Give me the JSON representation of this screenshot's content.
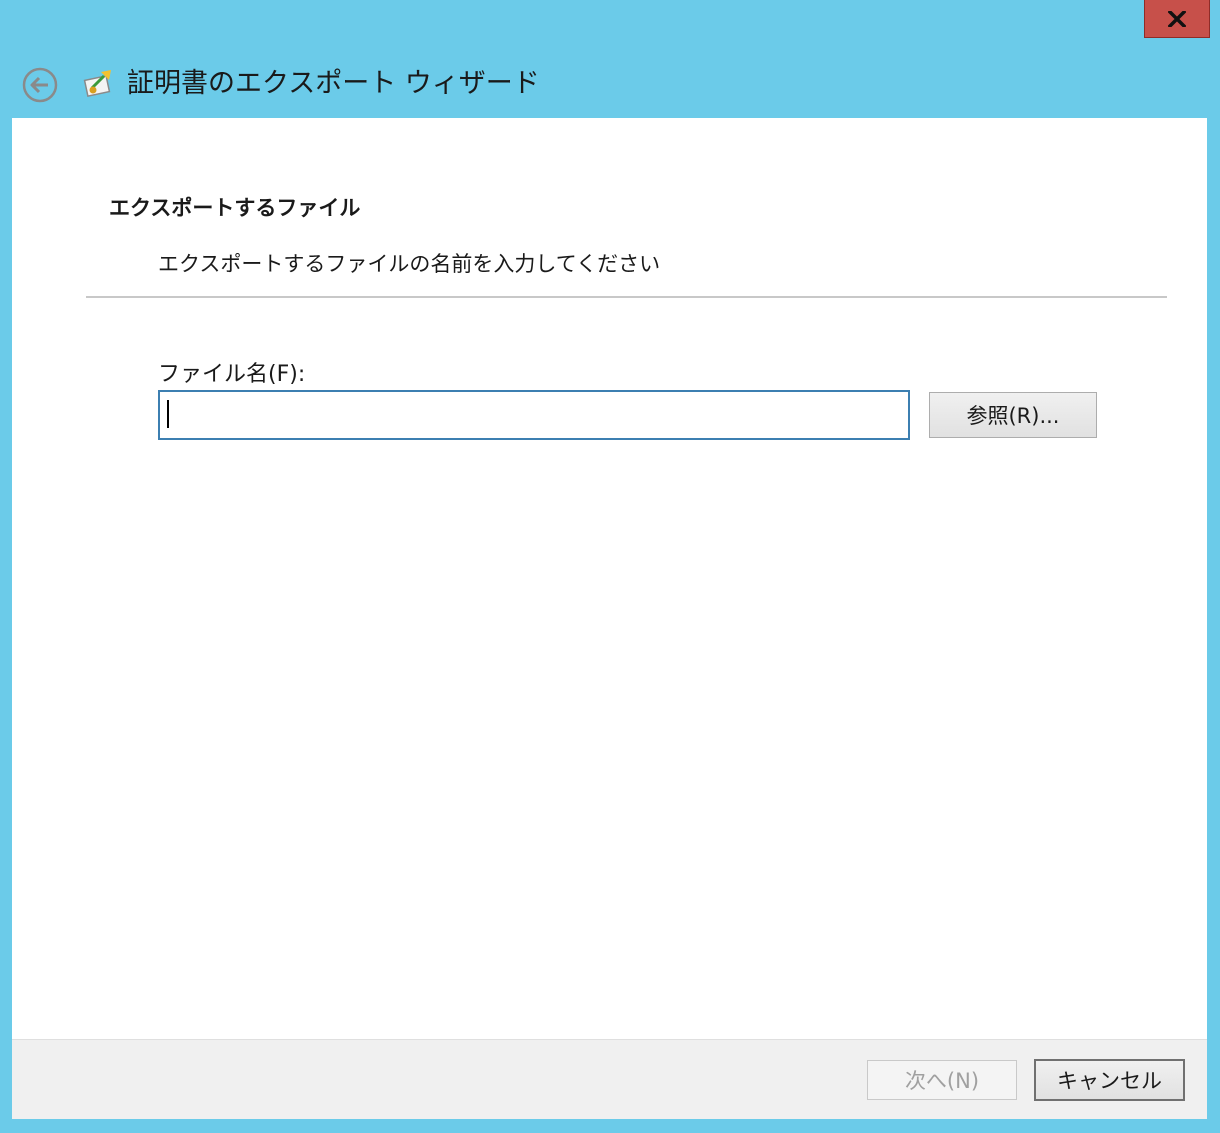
{
  "window": {
    "title": "証明書のエクスポート ウィザード",
    "close_label": "X",
    "back_icon": "back-arrow-icon",
    "wizard_icon": "certificate-wizard-icon"
  },
  "page": {
    "heading": "エクスポートするファイル",
    "description": "エクスポートするファイルの名前を入力してください"
  },
  "form": {
    "filename_label": "ファイル名(F):",
    "filename_value": "",
    "browse_label": "参照(R)..."
  },
  "footer": {
    "next_label": "次へ(N)",
    "cancel_label": "キャンセル"
  },
  "colors": {
    "title_bar": "#6bcbe9",
    "close_button": "#c7504a",
    "input_border": "#3c7fb1"
  }
}
